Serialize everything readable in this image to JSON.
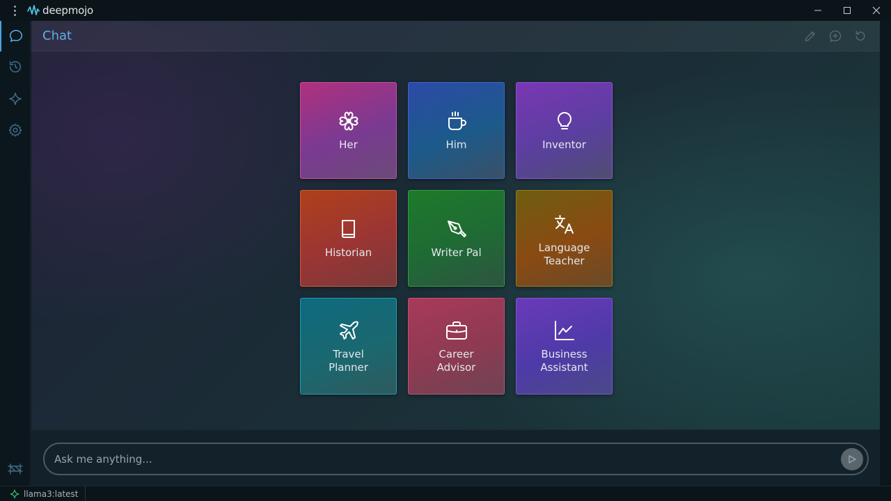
{
  "app": {
    "name": "deepmojo"
  },
  "colors": {
    "accent": "#4aa3e0",
    "status_icon": "#3fbf6a"
  },
  "titlebar": {
    "menu_icon": "vertical-dots-icon",
    "controls": [
      "minimize-icon",
      "maximize-icon",
      "close-icon"
    ]
  },
  "rail": {
    "items": [
      {
        "name": "chat",
        "icon": "chat-bubble-icon",
        "active": true
      },
      {
        "name": "history",
        "icon": "history-icon",
        "active": false
      },
      {
        "name": "sparkle",
        "icon": "sparkle-icon",
        "active": false
      },
      {
        "name": "settings",
        "icon": "gear-icon",
        "active": false
      }
    ],
    "bottom_icon": "network-icon"
  },
  "header": {
    "title": "Chat",
    "actions": [
      "pencil-icon",
      "add-chat-icon",
      "refresh-icon"
    ]
  },
  "personas": [
    {
      "label": "Her",
      "icon": "flower-icon",
      "theme": "pink"
    },
    {
      "label": "Him",
      "icon": "coffee-cup-icon",
      "theme": "blue"
    },
    {
      "label": "Inventor",
      "icon": "lightbulb-icon",
      "theme": "purple"
    },
    {
      "label": "Historian",
      "icon": "book-icon",
      "theme": "red"
    },
    {
      "label": "Writer Pal",
      "icon": "pen-nib-icon",
      "theme": "green"
    },
    {
      "label": "Language\nTeacher",
      "icon": "translate-icon",
      "theme": "amber"
    },
    {
      "label": "Travel\nPlanner",
      "icon": "airplane-icon",
      "theme": "teal"
    },
    {
      "label": "Career\nAdvisor",
      "icon": "briefcase-icon",
      "theme": "rose"
    },
    {
      "label": "Business\nAssistant",
      "icon": "chart-line-icon",
      "theme": "violet"
    }
  ],
  "chat_input": {
    "placeholder": "Ask me anything...",
    "value": "",
    "send_icon": "send-icon"
  },
  "statusbar": {
    "model": "llama3:latest",
    "model_icon": "sparkle-icon"
  }
}
